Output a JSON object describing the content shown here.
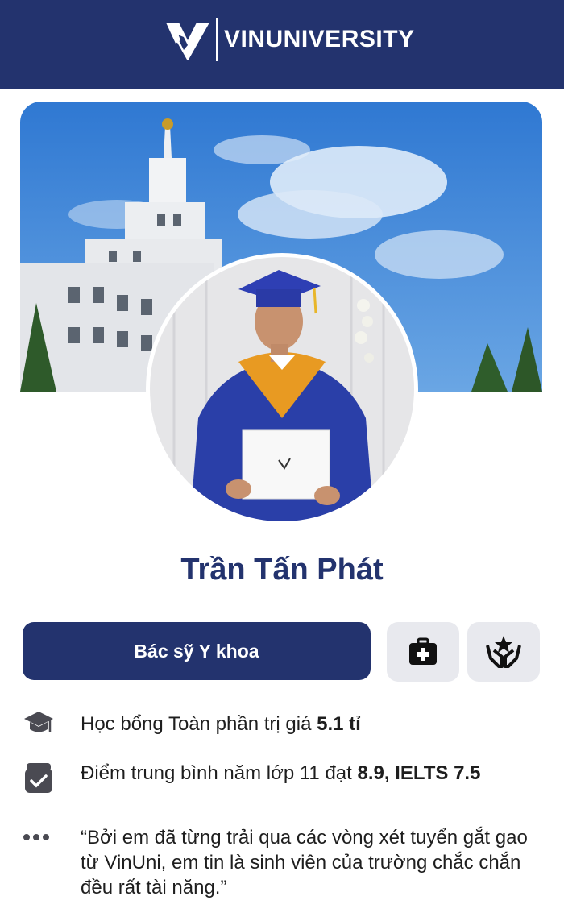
{
  "header": {
    "brand": "VINUNIVERSITY"
  },
  "profile": {
    "name": "Trần Tấn Phát",
    "major": "Bác sỹ Y khoa",
    "actions": [
      {
        "icon": "medical-kit-icon"
      },
      {
        "icon": "hands-holding-star-icon"
      }
    ]
  },
  "info": {
    "scholarship": {
      "icon": "graduation-cap-icon",
      "text": "Học bổng Toàn phần trị giá ",
      "highlight": "5.1 tỉ"
    },
    "scores": {
      "icon": "archive-box-icon",
      "text": "Điểm trung bình năm lớp 11 đạt ",
      "highlight": "8.9, IELTS 7.5"
    },
    "quote": {
      "icon": "more-dots-icon",
      "text": "“Bởi em đã từng trải qua các vòng xét tuyển gắt gao từ VinUni, em tin là sinh viên của trường chắc chắn đều rất tài năng.”"
    }
  },
  "colors": {
    "brand": "#23336e",
    "button_gray": "#e8e9ee",
    "gown": "#2a3fa8",
    "hood": "#e89a22"
  }
}
